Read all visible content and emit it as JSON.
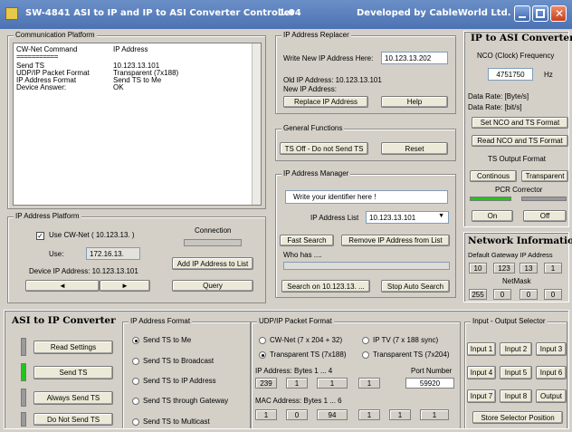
{
  "window": {
    "title_left": "SW-4841   ASI to IP and IP to ASI Converter Controller",
    "version": "1.04",
    "developer": "Developed by CableWorld Ltd."
  },
  "comm": {
    "title": "Communication Platform",
    "col1": "CW-Net Command",
    "col2": "IP Address",
    "sep": "===========",
    "rows": [
      [
        "Send TS",
        "10.123.13.101"
      ],
      [
        "UDP/IP Packet Format",
        "Transparent (7x188)"
      ],
      [
        "IP Address Format",
        "Send TS to Me"
      ],
      [
        "Device Answer:",
        "OK"
      ]
    ]
  },
  "ipplat": {
    "title": "IP Address  Platform",
    "use_cw": "Use  CW-Net  ( 10.123.13. )",
    "use_label": "Use:",
    "use_value": "172.16.13.",
    "connection": "Connection",
    "add_btn": "Add IP Address to List",
    "device": "Device IP Address: 10.123.13.101",
    "left": "◄",
    "right": "►",
    "query": "Query"
  },
  "replacer": {
    "title": "IP Address Replacer",
    "write_label": "Write New IP Address Here:",
    "write_value": "10.123.13.202",
    "old": "Old IP Address:   10.123.13.101",
    "new": "New IP Address:",
    "replace_btn": "Replace IP Address",
    "help_btn": "Help"
  },
  "general": {
    "title": "General Functions",
    "ts_off": "TS Off - Do not Send TS",
    "reset": "Reset"
  },
  "manager": {
    "title": "IP Address Manager",
    "identifier": "Write your identifier here !",
    "list_label": "IP Address List",
    "list_value": "10.123.13.101",
    "fast": "Fast Search",
    "remove": "Remove IP Address from List",
    "whohas": "Who has ....",
    "search_on": "Search on 10.123.13. ...",
    "stop": "Stop Auto Search"
  },
  "ipasi": {
    "title": "IP to ASI Converter",
    "nco_label": "NCO (Clock) Frequency",
    "nco_value": "4751750",
    "hz": "Hz",
    "rate_b": "Data Rate: [Byte/s]",
    "rate_bit": "Data Rate: [bit/s]",
    "set_btn": "Set NCO and TS Format",
    "read_btn": "Read NCO and TS Format",
    "ts_fmt": "TS Output Format",
    "continous": "Continous",
    "transparent": "Transparent",
    "pcr": "PCR Corrector",
    "on": "On",
    "off": "Off"
  },
  "network": {
    "title": "Network Information",
    "gateway_label": "Default Gateway IP Address",
    "gateway": [
      "10",
      "123",
      "13",
      "1"
    ],
    "netmask_label": "NetMask",
    "netmask": [
      "255",
      "0",
      "0",
      "0"
    ]
  },
  "asiip": {
    "title": "ASI to IP Converter",
    "read": "Read Settings",
    "send": "Send TS",
    "always": "Always Send TS",
    "donot": "Do Not Send TS"
  },
  "ipfmt": {
    "title": "IP Address Format",
    "options": [
      "Send TS to Me",
      "Send TS to Broadcast",
      "Send TS to IP Address",
      "Send TS through Gateway",
      "Send TS to Multicast"
    ]
  },
  "udp": {
    "title": "UDP/IP Packet Format",
    "opt1": "CW-Net (7 x 204 + 32)",
    "opt2": "IP TV (7 x 188  sync)",
    "opt3": "Transparent TS (7x188)",
    "opt4": "Transparent TS (7x204)",
    "ip_label": "IP Address:  Bytes 1 ... 4",
    "port_label": "Port Number",
    "ip": [
      "239",
      "1",
      "1",
      "1"
    ],
    "port": "59920",
    "mac_label": "MAC Address:  Bytes 1 ... 6",
    "mac": [
      "1",
      "0",
      "94",
      "1",
      "1",
      "1"
    ]
  },
  "selector": {
    "title": "Input - Output Selector",
    "buttons": [
      "Input 1",
      "Input 2",
      "Input 3",
      "Input 4",
      "Input 5",
      "Input 6",
      "Input 7",
      "Input 8",
      "Output"
    ],
    "store": "Store Selector Position"
  }
}
